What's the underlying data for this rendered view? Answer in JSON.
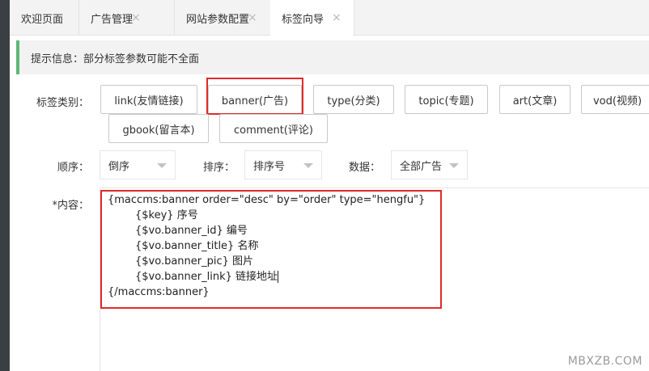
{
  "tabs": [
    {
      "label": "欢迎页面",
      "closable": false
    },
    {
      "label": "广告管理",
      "closable": true
    },
    {
      "label": "网站参数配置",
      "closable": true
    },
    {
      "label": "标签向导",
      "closable": true,
      "active": true
    }
  ],
  "close_glyph": "×",
  "notice": "提示信息：部分标签参数可能不全面",
  "category": {
    "label": "标签类别：",
    "buttons": [
      "link(友情链接)",
      "banner(广告)",
      "type(分类)",
      "topic(专题)",
      "art(文章)",
      "vod(视频)",
      "gbook(留言本)",
      "comment(评论)"
    ],
    "highlighted": "banner(广告)"
  },
  "filters": {
    "order_label": "顺序：",
    "order_value": "倒序",
    "sort_label": "排序：",
    "sort_value": "排序号",
    "data_label": "数据：",
    "data_value": "全部广告"
  },
  "content": {
    "label": "*内容：",
    "lines": [
      "{maccms:banner order=\"desc\" by=\"order\" type=\"hengfu\"}",
      "{$key} 序号",
      "{$vo.banner_id} 编号",
      "{$vo.banner_title} 名称",
      "{$vo.banner_pic} 图片",
      "{$vo.banner_link} 链接地址",
      "{/maccms:banner}"
    ]
  },
  "watermark": "MBXZB.COM",
  "colors": {
    "highlight_border": "#e02a2a",
    "notice_accent": "#5fb878",
    "sidebar": "#3a3f44"
  }
}
